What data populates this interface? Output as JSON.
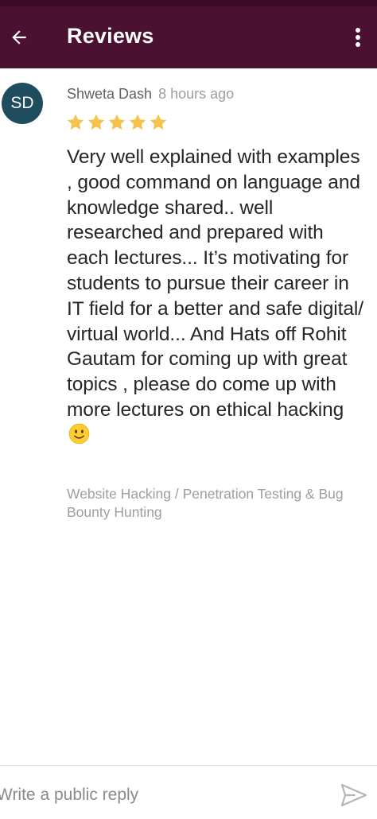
{
  "app_bar": {
    "title": "Reviews",
    "back_icon": "arrow-left-icon",
    "overflow_icon": "more-vertical-icon",
    "background": "#4a1130"
  },
  "review": {
    "avatar_initials": "SD",
    "avatar_color": "#1f4d5f",
    "author": "Shweta Dash",
    "time": "8 hours ago",
    "rating": 5,
    "rating_max": 5,
    "star_color": "#f4c24d",
    "body": "Very well explained with examples , good command on language and knowledge shared.. well researched and prepared with each lectures... It’s motivating for students to pursue their career in IT field for a better and safe digital/ virtual world... And Hats off Rohit Gautam for coming up with great topics , please do come up with more lectures on ethical hacking",
    "body_emoji": "slightly-smiling-face-icon",
    "course": "Website Hacking / Penetration Testing & Bug Bounty Hunting"
  },
  "reply": {
    "placeholder": "Write a public reply",
    "value": "",
    "send_icon": "send-icon"
  }
}
